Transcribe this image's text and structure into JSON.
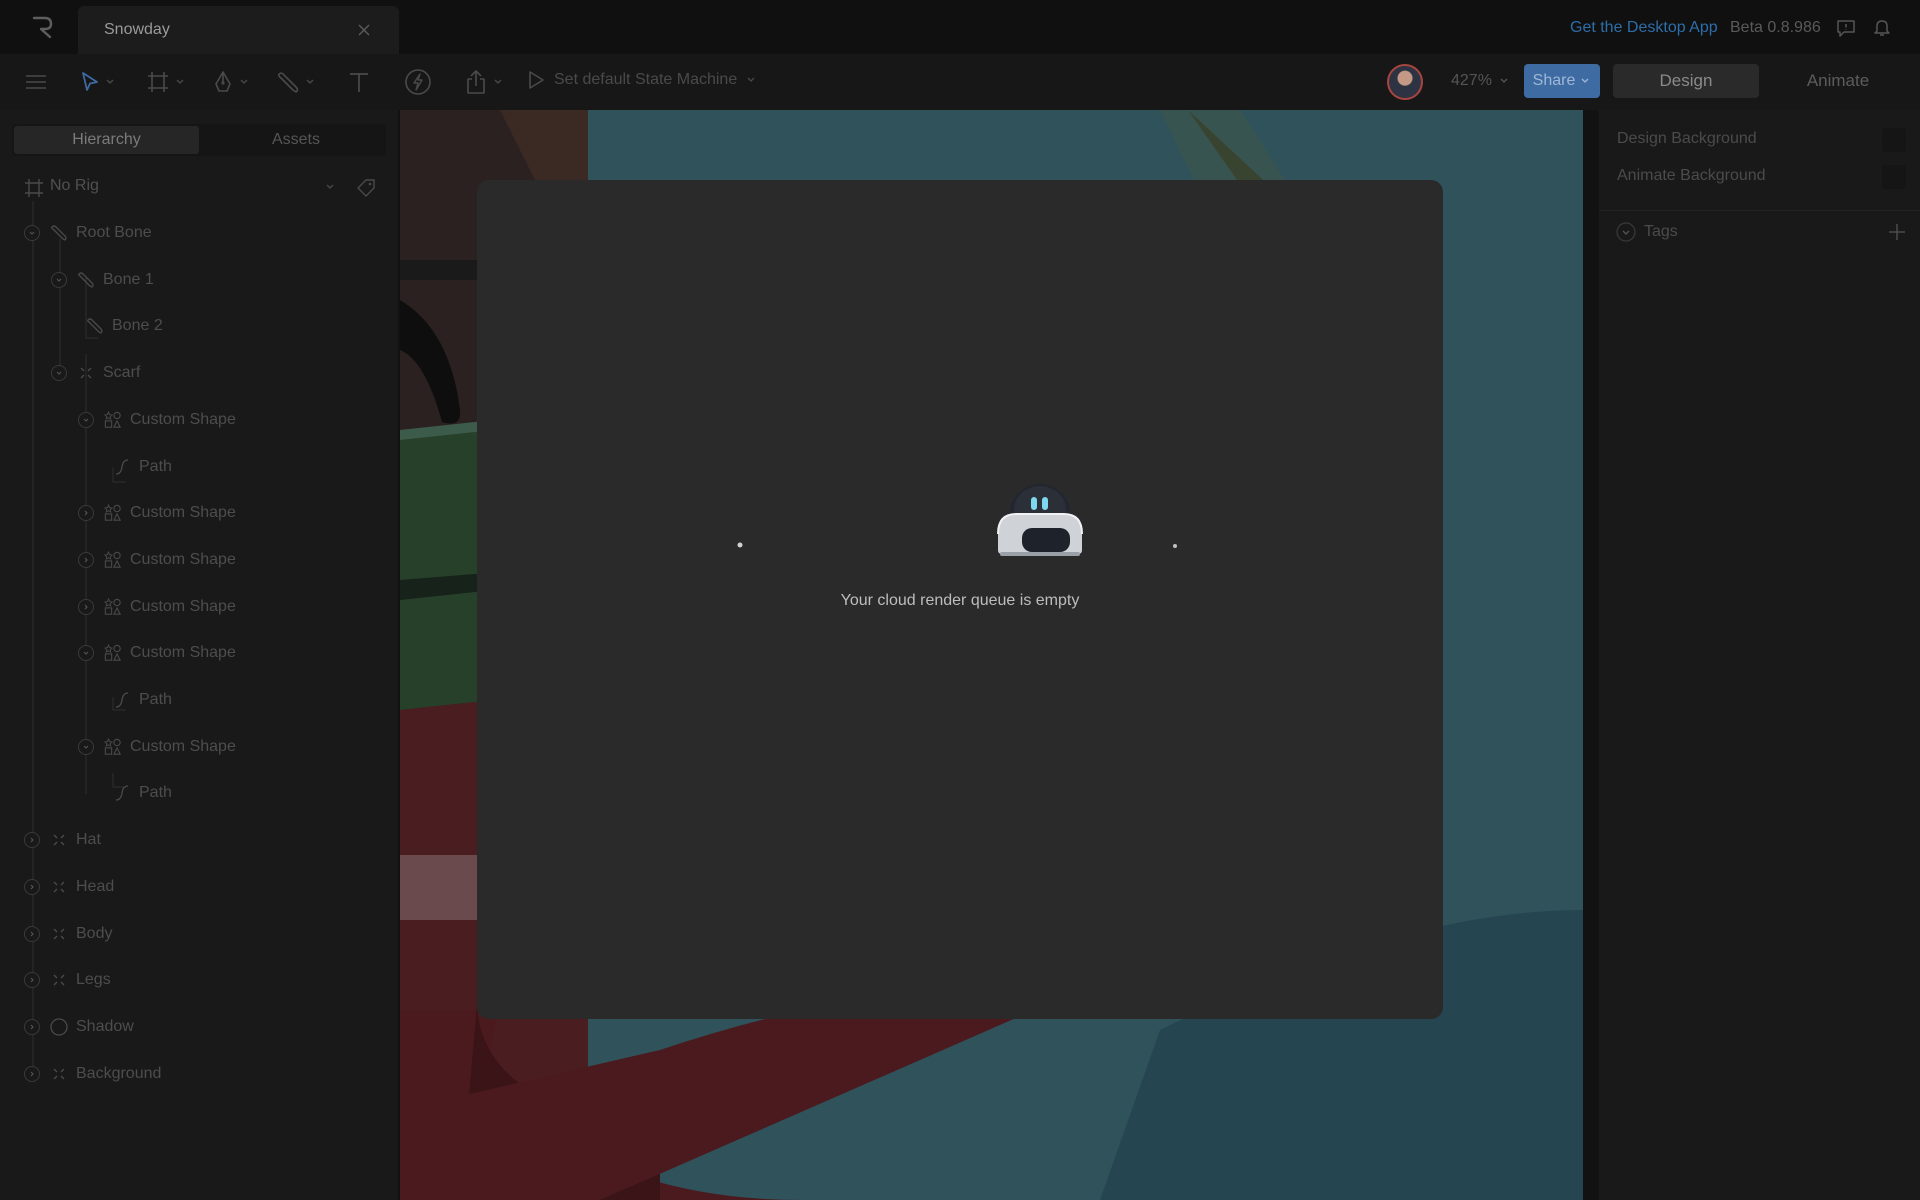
{
  "window": {
    "tab_title": "Snowday",
    "desktop_link": "Get the Desktop App",
    "version": "Beta 0.8.986"
  },
  "toolbar": {
    "state_machine_label": "Set default State Machine",
    "zoom": "427%",
    "share_label": "Share",
    "mode_design": "Design",
    "mode_animate": "Animate",
    "active_mode": "Design"
  },
  "left_panel": {
    "tab_hierarchy": "Hierarchy",
    "tab_assets": "Assets",
    "rig_label": "No Rig",
    "tree": [
      {
        "label": "Root Bone",
        "icon": "bone-icon",
        "expanded": true
      },
      {
        "label": "Bone 1",
        "icon": "bone-icon",
        "expanded": true
      },
      {
        "label": "Bone 2",
        "icon": "bone-icon",
        "expanded": null
      },
      {
        "label": "Scarf",
        "icon": "group-icon",
        "expanded": true
      },
      {
        "label": "Custom Shape",
        "icon": "shape-icon",
        "expanded": true
      },
      {
        "label": "Path",
        "icon": "path-icon",
        "expanded": null
      },
      {
        "label": "Custom Shape",
        "icon": "shape-icon",
        "expanded": false
      },
      {
        "label": "Custom Shape",
        "icon": "shape-icon",
        "expanded": false
      },
      {
        "label": "Custom Shape",
        "icon": "shape-icon",
        "expanded": false
      },
      {
        "label": "Custom Shape",
        "icon": "shape-icon",
        "expanded": true
      },
      {
        "label": "Path",
        "icon": "path-icon",
        "expanded": null
      },
      {
        "label": "Custom Shape",
        "icon": "shape-icon",
        "expanded": true
      },
      {
        "label": "Path",
        "icon": "path-icon",
        "expanded": null
      },
      {
        "label": "Hat",
        "icon": "group-icon",
        "expanded": false
      },
      {
        "label": "Head",
        "icon": "group-icon",
        "expanded": false
      },
      {
        "label": "Body",
        "icon": "group-icon",
        "expanded": false
      },
      {
        "label": "Legs",
        "icon": "group-icon",
        "expanded": false
      },
      {
        "label": "Shadow",
        "icon": "ellipse-icon",
        "expanded": false
      },
      {
        "label": "Background",
        "icon": "group-icon",
        "expanded": false
      }
    ]
  },
  "modal": {
    "message": "Your cloud render queue is empty"
  },
  "right_panel": {
    "design_background": "Design Background",
    "animate_background": "Animate Background",
    "tags_label": "Tags"
  },
  "colors": {
    "accent_blue": "#3f6ba3",
    "link_blue": "#2d6da8"
  }
}
